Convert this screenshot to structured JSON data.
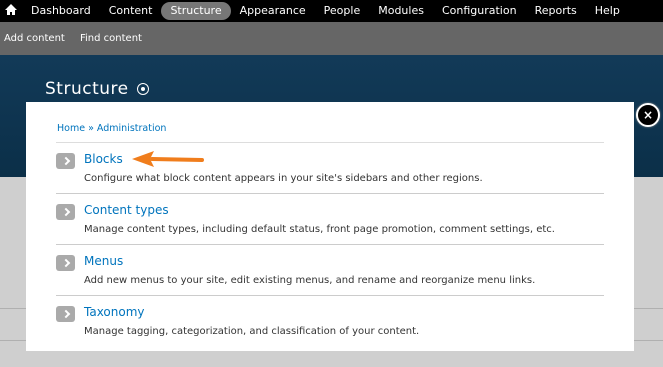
{
  "toolbar": {
    "menu": [
      {
        "label": "Dashboard",
        "active": false
      },
      {
        "label": "Content",
        "active": false
      },
      {
        "label": "Structure",
        "active": true
      },
      {
        "label": "Appearance",
        "active": false
      },
      {
        "label": "People",
        "active": false
      },
      {
        "label": "Modules",
        "active": false
      },
      {
        "label": "Configuration",
        "active": false
      },
      {
        "label": "Reports",
        "active": false
      },
      {
        "label": "Help",
        "active": false
      }
    ],
    "shortcuts": [
      "Add content",
      "Find content"
    ]
  },
  "page": {
    "title": "Structure"
  },
  "overlay": {
    "breadcrumb": "Home » Administration",
    "close_icon": "×",
    "items": [
      {
        "title": "Blocks",
        "description": "Configure what block content appears in your site's sidebars and other regions."
      },
      {
        "title": "Content types",
        "description": "Manage content types, including default status, front page promotion, comment settings, etc."
      },
      {
        "title": "Menus",
        "description": "Add new menus to your site, edit existing menus, and rename and reorganize menu links."
      },
      {
        "title": "Taxonomy",
        "description": "Manage tagging, categorization, and classification of your content."
      }
    ]
  },
  "colors": {
    "link": "#0074bd",
    "arrow": "#f07d1c",
    "toolbar": "#000000",
    "header": "#123a58"
  }
}
